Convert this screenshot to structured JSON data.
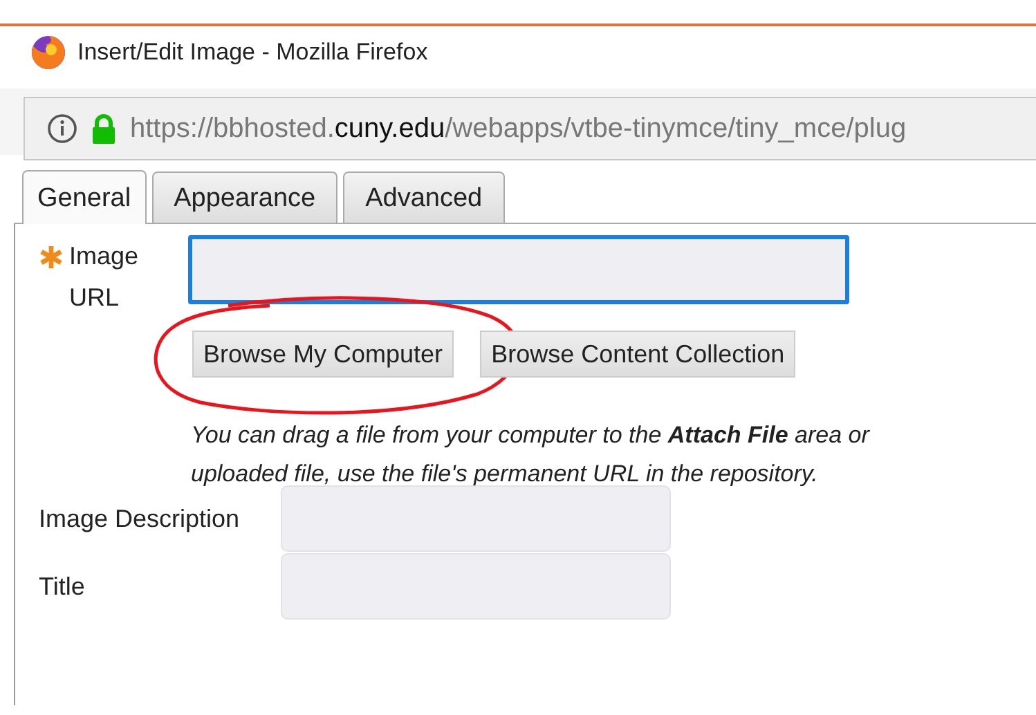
{
  "window": {
    "title": "Insert/Edit Image - Mozilla Firefox"
  },
  "address_bar": {
    "secure": true,
    "url_parts": [
      {
        "text": "https://bbhosted.",
        "emphasis": false
      },
      {
        "text": "cuny.edu",
        "emphasis": true
      },
      {
        "text": "/webapps/vtbe-tinymce/tiny_mce/plug",
        "emphasis": false
      }
    ]
  },
  "tabs": [
    {
      "label": "General",
      "selected": true
    },
    {
      "label": "Appearance",
      "selected": false
    },
    {
      "label": "Advanced",
      "selected": false
    }
  ],
  "image_url": {
    "label": "Image URL",
    "required": true,
    "focused": true
  },
  "buttons": [
    {
      "label": "Browse My Computer",
      "highlighted": true
    },
    {
      "label": "Browse Content Collection",
      "highlighted": false
    }
  ],
  "help_lines": [
    "You can drag a file from your computer to the **Attach File** area or",
    "uploaded file, use the file's permanent URL in the repository."
  ],
  "fields": [
    {
      "label": "Image Description",
      "focused": false
    },
    {
      "label": "Title",
      "focused": false
    }
  ]
}
